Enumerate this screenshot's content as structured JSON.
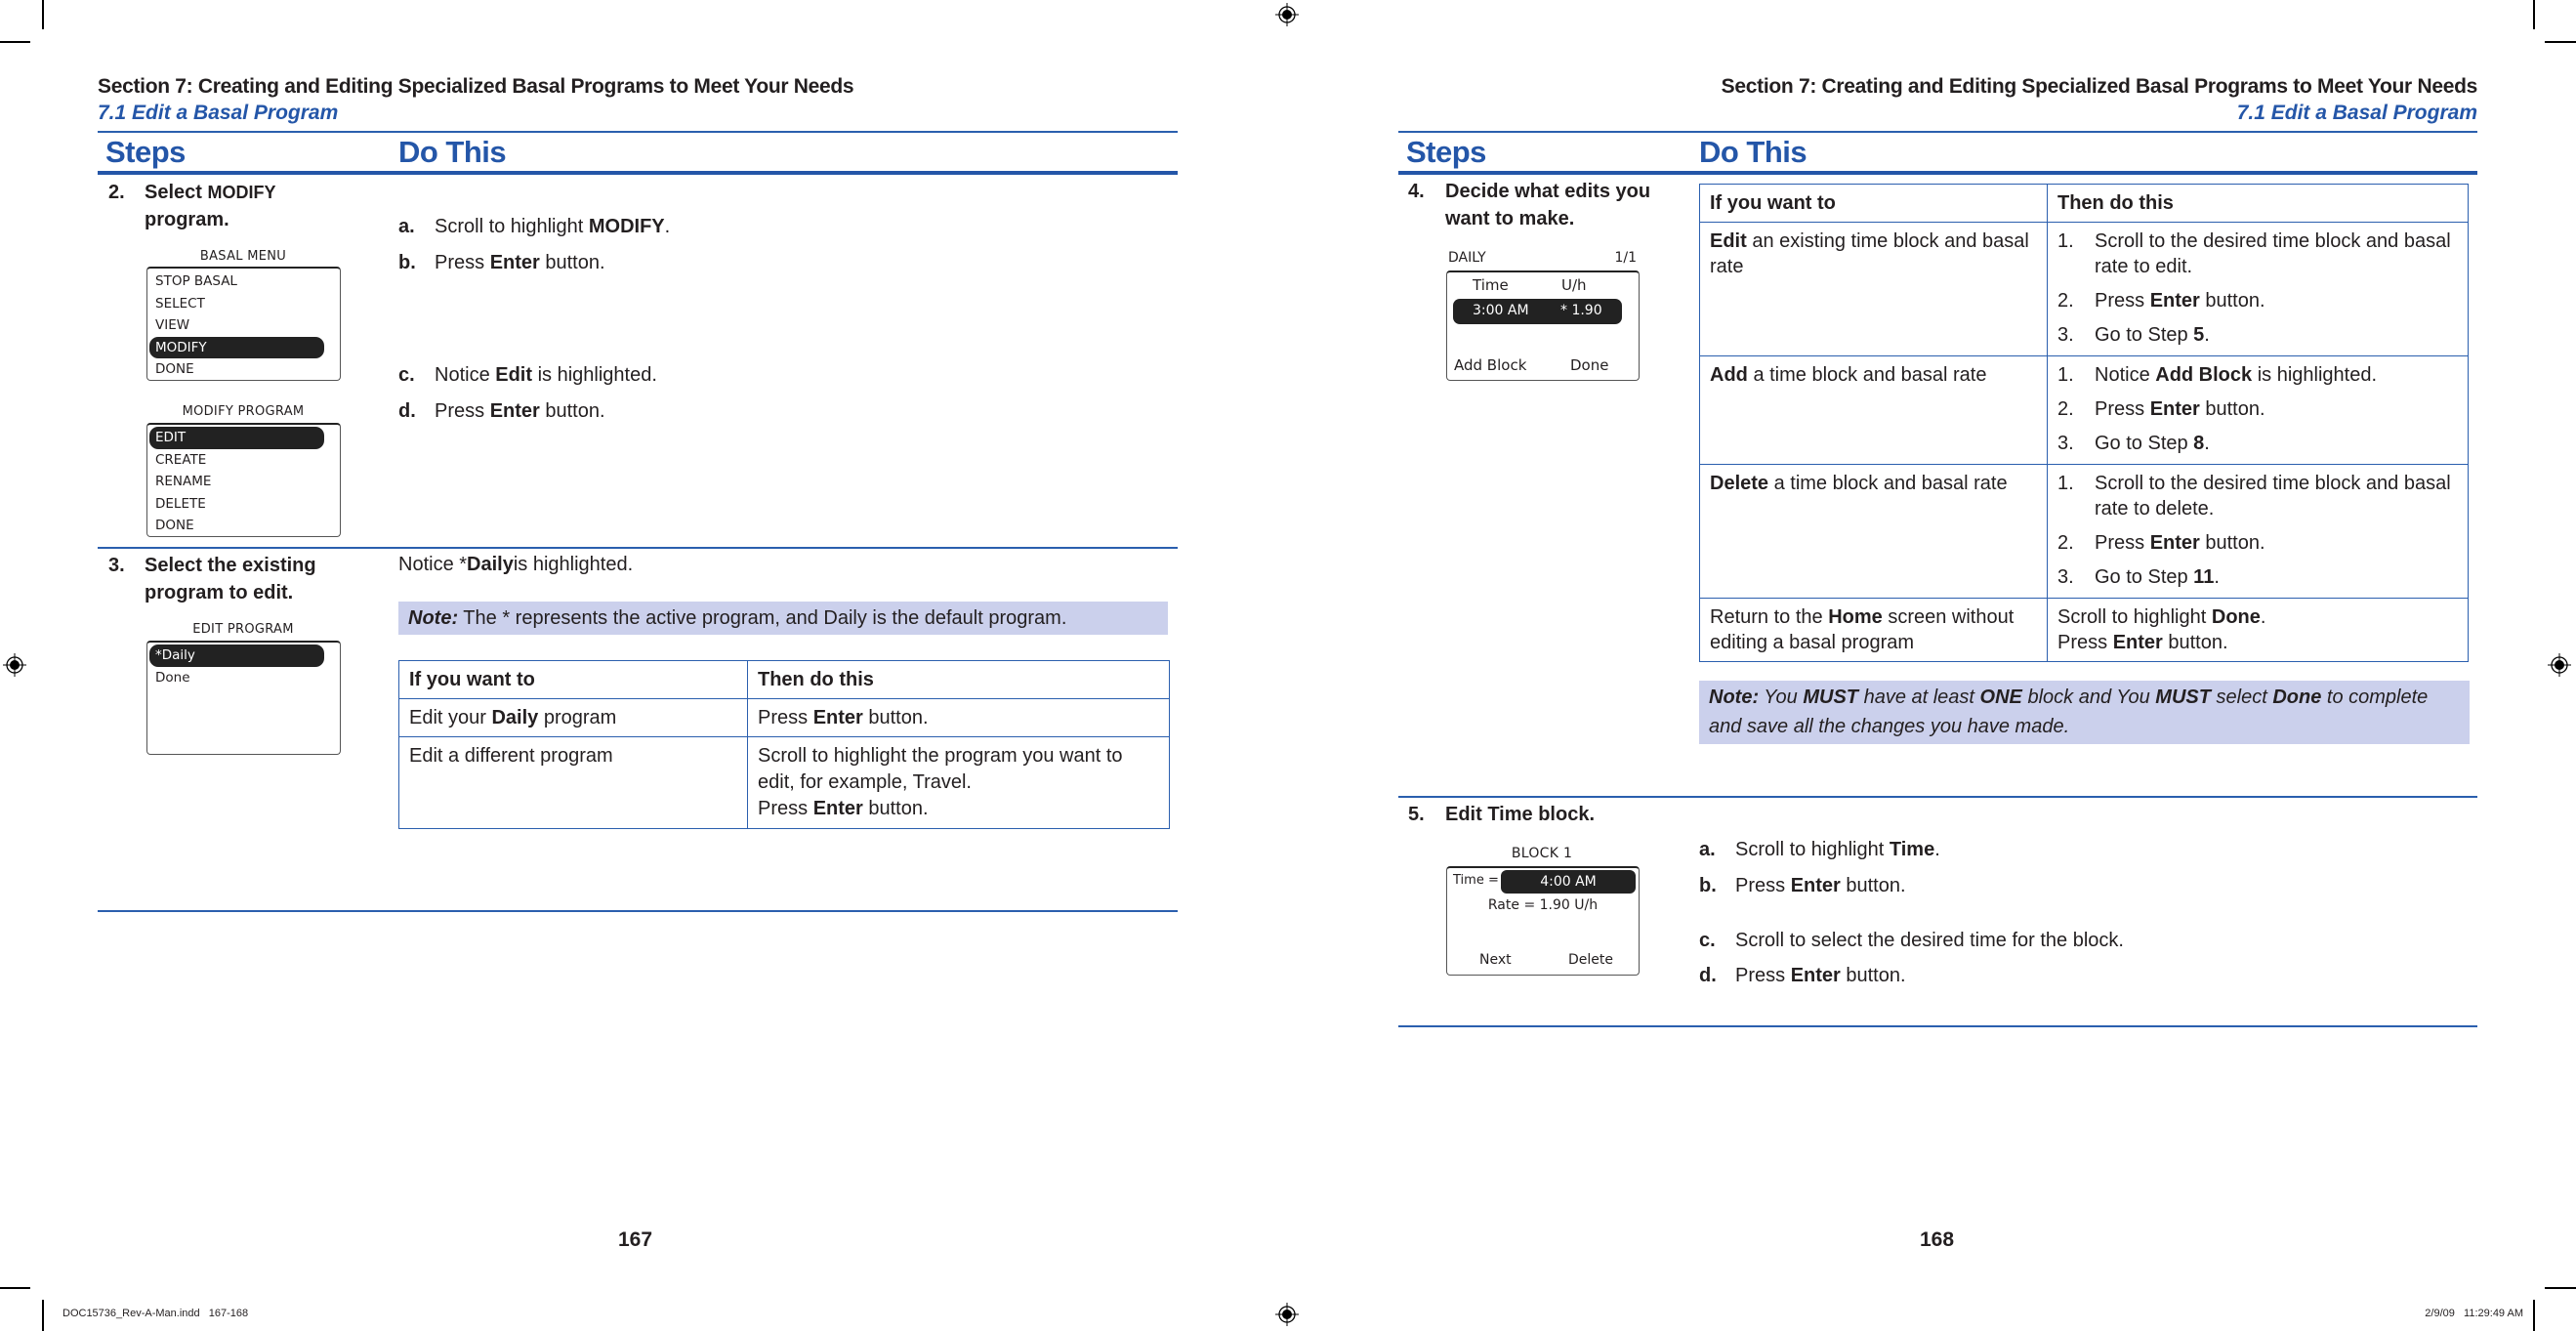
{
  "header": {
    "section_title": "Section 7: Creating and Editing Specialized Basal Programs to Meet Your Needs",
    "subsection_title": "7.1 Edit a Basal Program"
  },
  "columns": {
    "steps": "Steps",
    "do_this": "Do This"
  },
  "left_page": {
    "page_number": "167",
    "step2": {
      "number": "2.",
      "title_bold": "Select",
      "title_caps": "MODIFY",
      "title_line2": "program.",
      "screen1": {
        "title": "BASAL MENU",
        "items": [
          "STOP BASAL",
          "SELECT",
          "VIEW",
          "MODIFY",
          "DONE"
        ],
        "highlighted": "MODIFY"
      },
      "screen2": {
        "title": "MODIFY PROGRAM",
        "items": [
          "EDIT",
          "CREATE",
          "RENAME",
          "DELETE",
          "DONE"
        ],
        "highlighted": "EDIT"
      },
      "instructions": [
        {
          "label": "a.",
          "pre": "Scroll to highlight ",
          "bold": "MODIFY",
          "post": "."
        },
        {
          "label": "b.",
          "pre": "Press ",
          "bold": "Enter",
          "post": " button."
        },
        {
          "label": "c.",
          "pre": "Notice ",
          "bold": "Edit",
          "post": " is highlighted."
        },
        {
          "label": "d.",
          "pre": "Press ",
          "bold": "Enter",
          "post": " button."
        }
      ]
    },
    "step3": {
      "number": "3.",
      "title_line1": "Select the existing",
      "title_line2": "program to edit.",
      "screen": {
        "title": "EDIT PROGRAM",
        "items": [
          "*Daily",
          "Done"
        ],
        "highlighted": "*Daily"
      },
      "notice_pre": "Notice *",
      "notice_bold": "Daily",
      "notice_post": " is highlighted.",
      "note_label": "Note:",
      "note_text": " The * represents the active program, and Daily is the default program.",
      "table": {
        "headers": [
          "If you want to",
          "Then do this"
        ],
        "rows": [
          {
            "c1_pre": "Edit your ",
            "c1_bold": "Daily",
            "c1_post": " program",
            "c2_lines": [
              {
                "pre": "Press ",
                "bold": "Enter",
                "post": " button."
              }
            ]
          },
          {
            "c1_pre": "Edit a different program",
            "c1_bold": "",
            "c1_post": "",
            "c2_lines": [
              {
                "pre": "Scroll to highlight the program you want to edit, for example, Travel.",
                "bold": "",
                "post": ""
              },
              {
                "pre": "Press ",
                "bold": "Enter",
                "post": " button."
              }
            ]
          }
        ]
      }
    }
  },
  "right_page": {
    "page_number": "168",
    "step4": {
      "number": "4.",
      "title_line1": "Decide what edits you",
      "title_line2": "want to make.",
      "screen": {
        "title_left": "DAILY",
        "title_right": "1/1",
        "col_time": "Time",
        "col_rate": "U/h",
        "row_time": "3:00 AM",
        "row_rate": "* 1.90",
        "softkey_left": "Add Block",
        "softkey_right": "Done"
      },
      "table": {
        "headers": [
          "If you want to",
          "Then do this"
        ],
        "rows": [
          {
            "c1_bold": "Edit",
            "c1_post": " an existing time block and basal rate",
            "steps": [
              {
                "n": "1.",
                "pre": "Scroll to the desired time block and basal rate to edit.",
                "bold": "",
                "post": ""
              },
              {
                "n": "2.",
                "pre": "Press ",
                "bold": "Enter",
                "post": " button."
              },
              {
                "n": "3.",
                "pre": "Go to Step ",
                "bold": "5",
                "post": "."
              }
            ]
          },
          {
            "c1_bold": "Add",
            "c1_post": " a time block and basal rate",
            "steps": [
              {
                "n": "1.",
                "pre": "Notice ",
                "bold": "Add Block",
                "post": " is highlighted."
              },
              {
                "n": "2.",
                "pre": "Press ",
                "bold": "Enter",
                "post": " button."
              },
              {
                "n": "3.",
                "pre": "Go to Step ",
                "bold": "8",
                "post": "."
              }
            ]
          },
          {
            "c1_bold": "Delete",
            "c1_post": " a time block and basal rate",
            "steps": [
              {
                "n": "1.",
                "pre": "Scroll to the desired time block and basal rate to delete.",
                "bold": "",
                "post": ""
              },
              {
                "n": "2.",
                "pre": "Press ",
                "bold": "Enter",
                "post": " button."
              },
              {
                "n": "3.",
                "pre": "Go to Step ",
                "bold": "11",
                "post": "."
              }
            ]
          }
        ],
        "last_row": {
          "c1_pre": "Return to the ",
          "c1_bold": "Home",
          "c1_post": " screen without editing a basal program",
          "c2_line1_pre": "Scroll to highlight ",
          "c2_line1_bold": "Done",
          "c2_line1_post": ".",
          "c2_line2_pre": "Press ",
          "c2_line2_bold": "Enter",
          "c2_line2_post": " button."
        }
      },
      "note": {
        "label": "Note:",
        "parts": [
          {
            "t": " You ",
            "b": false
          },
          {
            "t": "MUST",
            "b": true
          },
          {
            "t": " have at least ",
            "b": false
          },
          {
            "t": "ONE",
            "b": true
          },
          {
            "t": " block and You ",
            "b": false
          },
          {
            "t": "MUST",
            "b": true
          },
          {
            "t": " select ",
            "b": false
          },
          {
            "t": "Done",
            "b": true
          },
          {
            "t": " to complete and save all the changes you have made.",
            "b": false
          }
        ]
      }
    },
    "step5": {
      "number": "5.",
      "title": "Edit Time block.",
      "screen": {
        "title": "BLOCK 1",
        "time_label": "Time =",
        "time_value": "4:00 AM",
        "rate_line": "Rate = 1.90 U/h",
        "softkey_left": "Next",
        "softkey_right": "Delete"
      },
      "instructions": [
        {
          "label": "a.",
          "pre": "Scroll to highlight ",
          "bold": "Time",
          "post": "."
        },
        {
          "label": "b.",
          "pre": "Press ",
          "bold": "Enter",
          "post": " button."
        },
        {
          "label": "c.",
          "pre": "Scroll to select the desired time for the block.",
          "bold": "",
          "post": ""
        },
        {
          "label": "d.",
          "pre": "Press ",
          "bold": "Enter",
          "post": " button."
        }
      ]
    }
  },
  "slug": {
    "file": "DOC15736_Rev-A-Man.indd   167-168",
    "timestamp": "2/9/09   11:29:49 AM"
  },
  "colors": {
    "accent_blue": "#2456a8",
    "note_background": "#cbd0ec",
    "rule_blue": "#2b5fae"
  }
}
